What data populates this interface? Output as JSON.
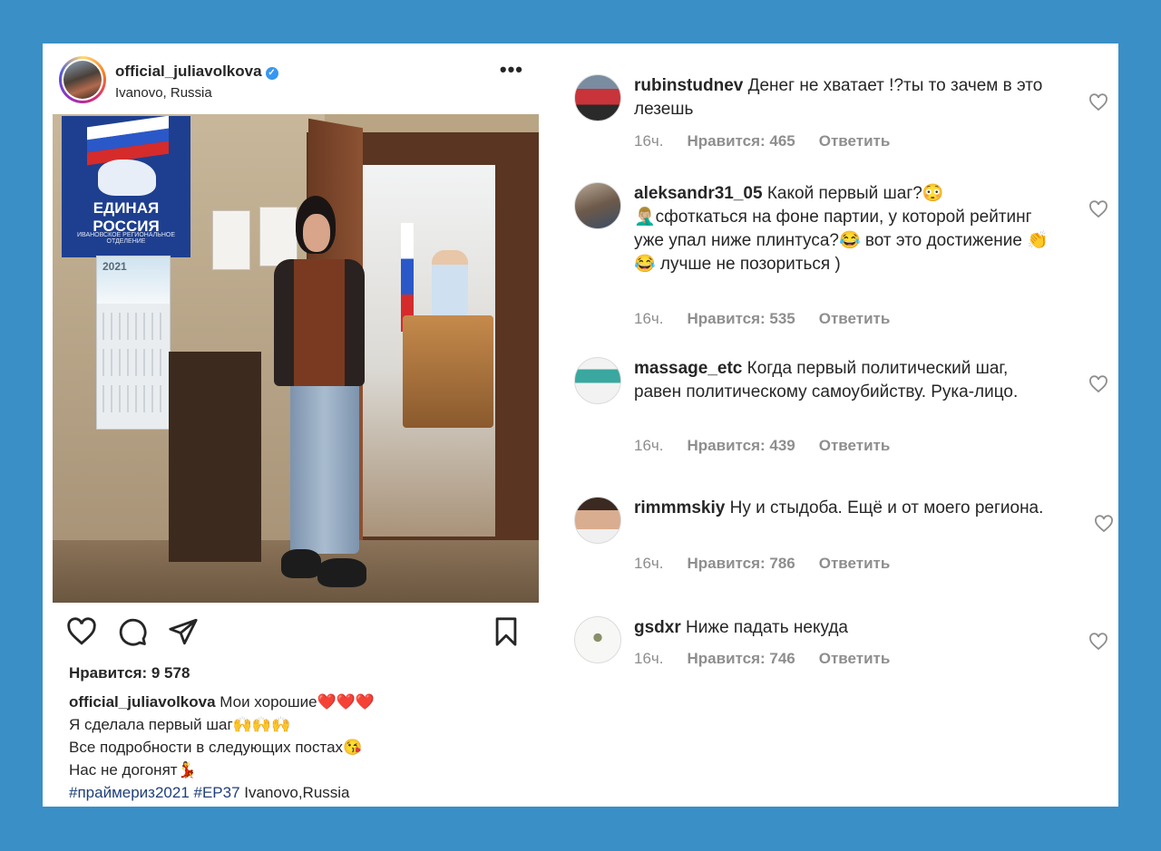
{
  "post": {
    "username": "official_juliavolkova",
    "location": "Ivanovo, Russia",
    "more_label": "•••",
    "likes_text": "Нравится: 9 578",
    "caption": {
      "username": "official_juliavolkova",
      "line1_text": " Мои хорошие❤️❤️❤️",
      "line2": "Я сделала первый шаг🙌🙌🙌",
      "line3": "Все подробности в следующих постах😘",
      "line4": "Нас не догонят💃",
      "hashtag1": "#праймериз2021",
      "hashtag2": "#ЕР37",
      "location_tail": " Ivanovo,Russia"
    },
    "photo_text": {
      "poster_title": "ЕДИНАЯ РОССИЯ",
      "poster_sub": "ИВАНОВСКОЕ РЕГИОНАЛЬНОЕ ОТДЕЛЕНИЕ",
      "calendar_year": "2021"
    }
  },
  "comments": [
    {
      "username": "rubinstudnev",
      "text": " Денег не хватает !?ты то зачем в это лезешь",
      "time": "16ч.",
      "likes": "Нравится: 465",
      "reply": "Ответить"
    },
    {
      "username": "aleksandr31_05",
      "text": " Какой первый шаг?😳🤦🏼‍♂️сфоткаться на фоне партии, у которой рейтинг уже упал ниже плинтуса?😂 вот это достижение 👏😂 лучше не позориться )",
      "time": "16ч.",
      "likes": "Нравится: 535",
      "reply": "Ответить"
    },
    {
      "username": "massage_etc",
      "text": " Когда первый политический шаг, равен политическому самоубийству. Рука-лицо.",
      "time": "16ч.",
      "likes": "Нравится: 439",
      "reply": "Ответить"
    },
    {
      "username": "rimmmskiy",
      "text": " Ну и стыдоба. Ещё и от моего региона.",
      "time": "16ч.",
      "likes": "Нравится: 786",
      "reply": "Ответить"
    },
    {
      "username": "gsdxr",
      "text": " Ниже падать некуда",
      "time": "16ч.",
      "likes": "Нравится: 746",
      "reply": "Ответить"
    }
  ],
  "colors": {
    "background": "#3a8fc6",
    "text": "#262626",
    "muted": "#8e8e8e",
    "hashtag": "#1f3f7a",
    "verified": "#3897f0"
  }
}
